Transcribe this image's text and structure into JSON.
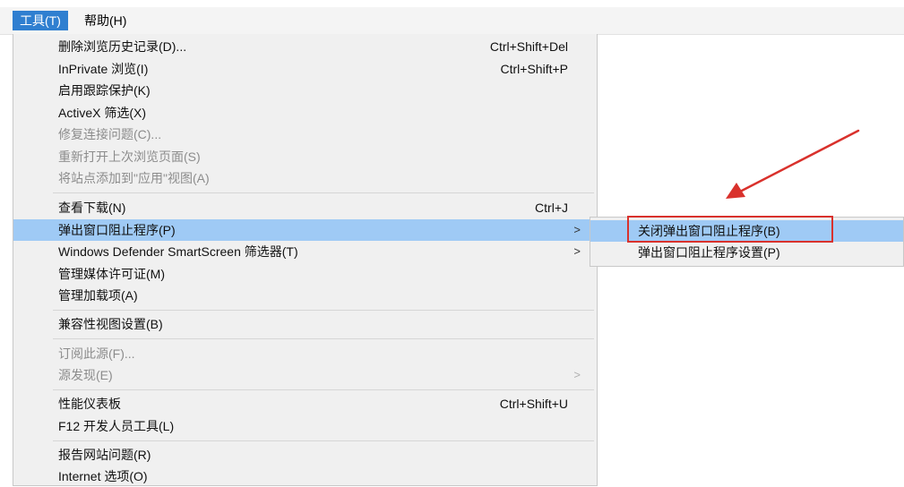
{
  "menubar": {
    "tools": "工具(T)",
    "help": "帮助(H)"
  },
  "tools_menu": {
    "items": [
      {
        "label": "删除浏览历史记录(D)...",
        "shortcut": "Ctrl+Shift+Del"
      },
      {
        "label": "InPrivate 浏览(I)",
        "shortcut": "Ctrl+Shift+P"
      },
      {
        "label": "启用跟踪保护(K)"
      },
      {
        "label": "ActiveX 筛选(X)"
      },
      {
        "label": "修复连接问题(C)...",
        "disabled": true
      },
      {
        "label": "重新打开上次浏览页面(S)",
        "disabled": true
      },
      {
        "label": "将站点添加到\"应用\"视图(A)",
        "disabled": true
      },
      {
        "label": "查看下载(N)",
        "shortcut": "Ctrl+J"
      },
      {
        "label": "弹出窗口阻止程序(P)",
        "submenu": true,
        "highlighted": true
      },
      {
        "label": "Windows Defender SmartScreen 筛选器(T)",
        "submenu": true
      },
      {
        "label": "管理媒体许可证(M)"
      },
      {
        "label": "管理加载项(A)"
      },
      {
        "label": "兼容性视图设置(B)"
      },
      {
        "label": "订阅此源(F)...",
        "disabled": true
      },
      {
        "label": "源发现(E)",
        "disabled": true,
        "submenu": true
      },
      {
        "label": "性能仪表板",
        "shortcut": "Ctrl+Shift+U"
      },
      {
        "label": "F12 开发人员工具(L)"
      },
      {
        "label": "报告网站问题(R)"
      },
      {
        "label": "Internet 选项(O)"
      }
    ],
    "submenu_glyph": ">"
  },
  "popup_submenu": {
    "items": [
      {
        "label": "关闭弹出窗口阻止程序(B)",
        "highlighted": true
      },
      {
        "label": "弹出窗口阻止程序设置(P)"
      }
    ]
  },
  "colors": {
    "highlight": "#9fcaf5",
    "menubar_active": "#2f7fd0",
    "annotation": "#d9312c"
  }
}
